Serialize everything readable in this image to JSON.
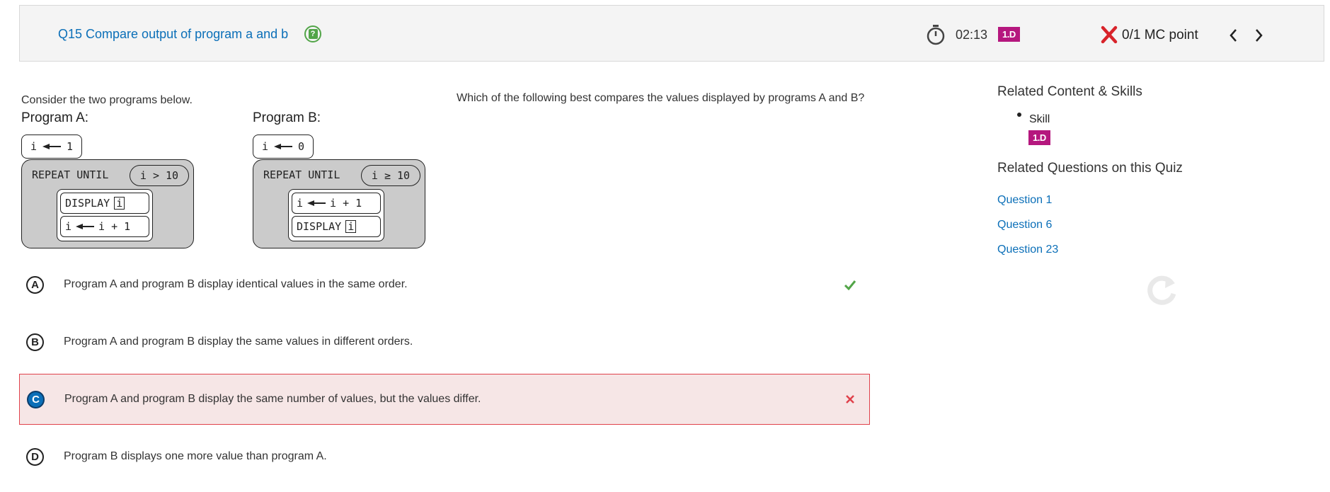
{
  "header": {
    "question_title": "Q15 Compare output of program a and b",
    "help_icon": "question-mark-icon",
    "timer_icon": "stopwatch-icon",
    "timer": "02:13",
    "skill_badge": "1.D",
    "result_icon": "x-mark-icon",
    "score": "0/1 MC point",
    "prev_icon": "chevron-left-icon",
    "next_icon": "chevron-right-icon"
  },
  "question": {
    "intro": "Consider the two programs below.",
    "prompt": "Which of the following best compares the values displayed by programs A and B?",
    "program_a": {
      "label": "Program A:",
      "init_var": "i",
      "init_val": "1",
      "repeat_label": "REPEAT UNTIL",
      "cond_var": "i",
      "cond_op": ">",
      "cond_val": "10",
      "stmt1_keyword": "DISPLAY",
      "stmt1_arg": "i",
      "stmt2_var": "i",
      "stmt2_expr": "i + 1"
    },
    "program_b": {
      "label": "Program B:",
      "init_var": "i",
      "init_val": "0",
      "repeat_label": "REPEAT UNTIL",
      "cond_var": "i",
      "cond_op": "≥",
      "cond_val": "10",
      "stmt1_var": "i",
      "stmt1_expr": "i + 1",
      "stmt2_keyword": "DISPLAY",
      "stmt2_arg": "i"
    }
  },
  "choices": [
    {
      "letter": "A",
      "text": "Program A and program B display identical values in the same order.",
      "status": "correct",
      "icon": "checkmark-icon"
    },
    {
      "letter": "B",
      "text": "Program A and program B display the same values in different orders.",
      "status": "none"
    },
    {
      "letter": "C",
      "text": "Program A and program B display the same number of values, but the values differ.",
      "status": "selected-incorrect",
      "icon": "x-icon"
    },
    {
      "letter": "D",
      "text": "Program B displays one more value than program A.",
      "status": "none"
    }
  ],
  "sidebar": {
    "related_content_heading": "Related Content & Skills",
    "skill_label": "Skill",
    "skill_badge": "1.D",
    "related_questions_heading": "Related Questions on this Quiz",
    "related_questions": [
      "Question 1",
      "Question 6",
      "Question 23"
    ],
    "refresh_icon": "refresh-icon"
  },
  "colors": {
    "link_blue": "#0b6fb8",
    "badge_magenta": "#b5177e",
    "correct_green": "#52a548",
    "incorrect_red": "#e0414b",
    "incorrect_bg": "#f6e6e6",
    "code_block_gray": "#cbcbcb"
  }
}
